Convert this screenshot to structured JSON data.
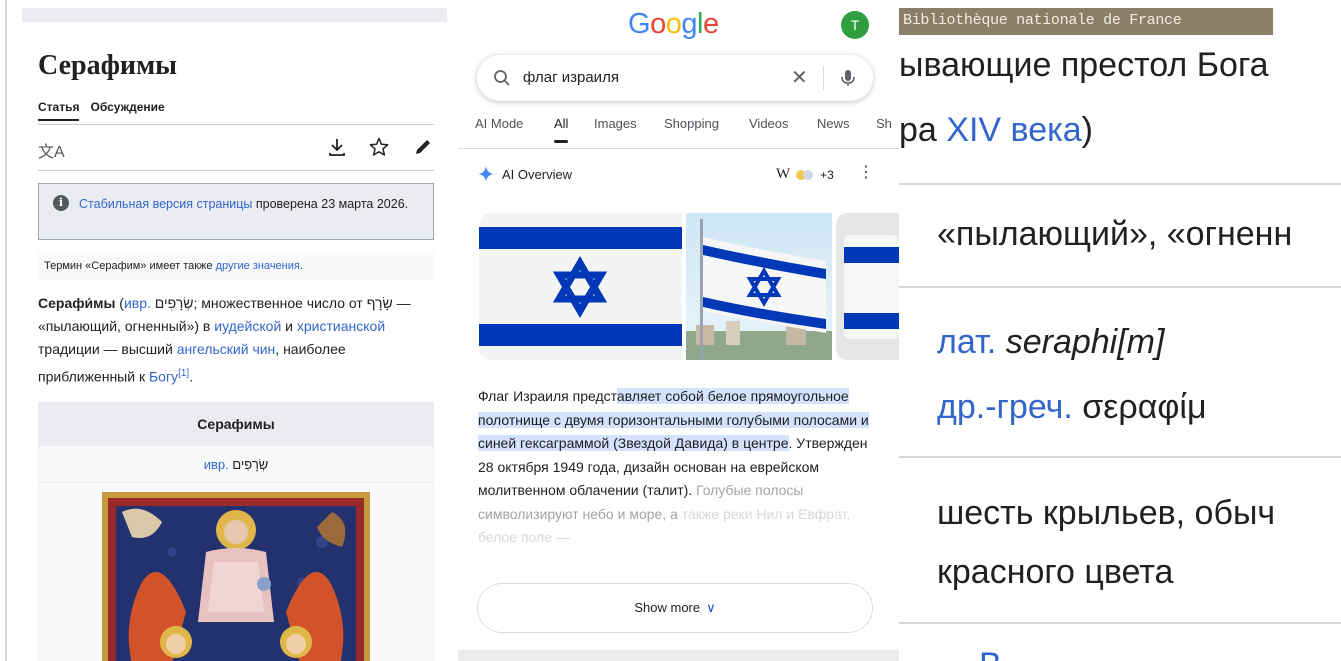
{
  "colors": {
    "wiki_link": "#3366cc",
    "google_highlight": "#d3e3fd",
    "google_blue": "#4285f4",
    "google_red": "#ea4335",
    "google_yellow": "#fbbc05",
    "google_green": "#34a853",
    "israel_blue": "#0038b8",
    "avatar_green": "#2e9e3e"
  },
  "wiki": {
    "title": "Серафимы",
    "tabs": [
      "Статья",
      "Обсуждение"
    ],
    "tools": [
      "translate-icon",
      "download-icon",
      "star-icon",
      "edit-icon"
    ],
    "notice": {
      "link": "Стабильная версия страницы",
      "text": " проверена 23 марта 2026."
    },
    "hatnote": {
      "text": "Термин «Серафим» имеет также ",
      "link": "другие значения",
      "end": "."
    },
    "paragraph": {
      "bold": "Серафи́мы",
      "p1": " (",
      "l1": "ивр.",
      "p2": " שְׂרָפִים; множественное число от שָׂרָף — «пылающий, огненный») в ",
      "l2": "иудейской",
      "p3": " и ",
      "l3": "христианской",
      "p4": " традиции — высший ",
      "l4": "ангельский чин",
      "p5": ", наиболее приближенный к ",
      "l5": "Богу",
      "ref": "[1]",
      "p6": "."
    },
    "infobox": {
      "header": "Серафимы",
      "sub_link": "ивр.",
      "sub_text": " שְׂרָפִים"
    }
  },
  "google": {
    "logo": [
      "G",
      "o",
      "o",
      "g",
      "l",
      "e"
    ],
    "avatar": "T",
    "query": "флаг израиля",
    "tabs": [
      "AI Mode",
      "All",
      "Images",
      "Shopping",
      "Videos",
      "News",
      "Sh"
    ],
    "active_tab": "All",
    "ai_overview_label": "AI Overview",
    "sources_w": "W",
    "sources_count": "+3",
    "overview": {
      "a": "Флаг Израиля предст",
      "b": "авляет собой белое прямоугольное полотнище с двумя горизонтальными голубыми полосами и синей гексаграммой (Звездой Давида) в центре",
      "c": ". Утвержден 28 октября 1949 года, дизайн основан на еврейском молитвенном облачении (талит). ",
      "d": "Голубые полосы символизируют небо и море, а ",
      "e": "также реки Нил и Евфрат, белое поле —"
    },
    "show_more": "Show more"
  },
  "zoom": {
    "banner": "Bibliothèque nationale de France",
    "line1": "ывающие престол Бога",
    "line2_a": "ра ",
    "line2_link": "XIV века",
    "line2_b": ")",
    "line3": "«пылающий», «огненн",
    "line4_link": "лат.",
    "line4_text": " seraphi[m]",
    "line5_link": "др.-греч.",
    "line5_text": " σεραφίμ",
    "line6": "шесть крыльев, обыч",
    "line7": "красного цвета",
    "line8": "В"
  }
}
